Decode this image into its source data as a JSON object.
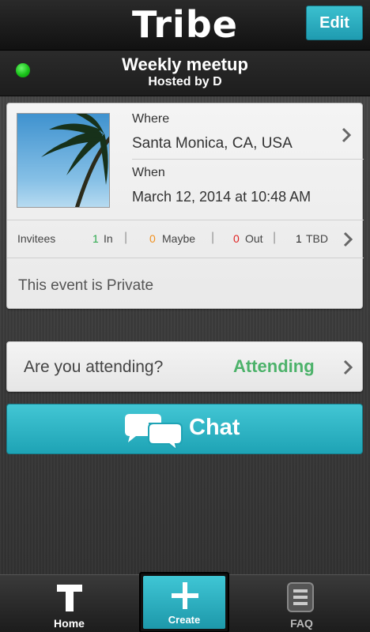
{
  "header": {
    "app_title": "Tribe",
    "edit_label": "Edit"
  },
  "event": {
    "title": "Weekly meetup",
    "host": "Hosted by D",
    "status_color": "#19c219",
    "where_label": "Where",
    "where_value": "Santa Monica, CA, USA",
    "when_label": "When",
    "when_value": "March 12, 2014 at 10:48 AM",
    "invitees": {
      "label": "Invitees",
      "in_count": "1",
      "in_label": "In",
      "maybe_count": "0",
      "maybe_label": "Maybe",
      "out_count": "0",
      "out_label": "Out",
      "tbd_count": "1",
      "tbd_label": "TBD"
    },
    "privacy": "This event is Private"
  },
  "attending": {
    "question": "Are you attending?",
    "status": "Attending",
    "status_color": "#4cb26a"
  },
  "chat": {
    "label": "Chat"
  },
  "tabbar": {
    "home_label": "Home",
    "create_label": "Create",
    "faq_label": "FAQ"
  },
  "colors": {
    "accent": "#1ea3b5",
    "in": "#2aa84a",
    "maybe": "#f0901e",
    "out": "#e02020"
  }
}
